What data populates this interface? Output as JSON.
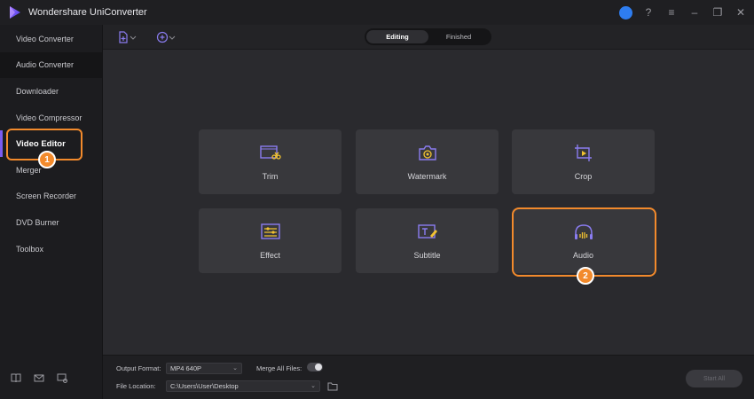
{
  "app": {
    "title": "Wondershare UniConverter"
  },
  "sidebar": {
    "items": [
      {
        "label": "Video Converter"
      },
      {
        "label": "Audio Converter"
      },
      {
        "label": "Downloader"
      },
      {
        "label": "Video Compressor"
      },
      {
        "label": "Video Editor"
      },
      {
        "label": "Merger"
      },
      {
        "label": "Screen Recorder"
      },
      {
        "label": "DVD Burner"
      },
      {
        "label": "Toolbox"
      }
    ],
    "active": "Video Editor"
  },
  "toolbar": {
    "tabs": [
      {
        "label": "Editing"
      },
      {
        "label": "Finished"
      }
    ],
    "active_tab": "Editing"
  },
  "editor": {
    "tools": [
      {
        "label": "Trim",
        "icon": "trim-icon"
      },
      {
        "label": "Watermark",
        "icon": "watermark-icon"
      },
      {
        "label": "Crop",
        "icon": "crop-icon"
      },
      {
        "label": "Effect",
        "icon": "effect-icon"
      },
      {
        "label": "Subtitle",
        "icon": "subtitle-icon"
      },
      {
        "label": "Audio",
        "icon": "audio-icon"
      }
    ]
  },
  "annotations": {
    "step1": "1",
    "step2": "2"
  },
  "bottom": {
    "output_format_label": "Output Format:",
    "output_format_value": "MP4 640P",
    "merge_label": "Merge All Files:",
    "file_location_label": "File Location:",
    "file_location_value": "C:\\Users\\User\\Desktop",
    "start_all_label": "Start All"
  },
  "colors": {
    "accent": "#7b5cf0",
    "highlight": "#f28a2c",
    "icon_yellow": "#f2c230"
  }
}
